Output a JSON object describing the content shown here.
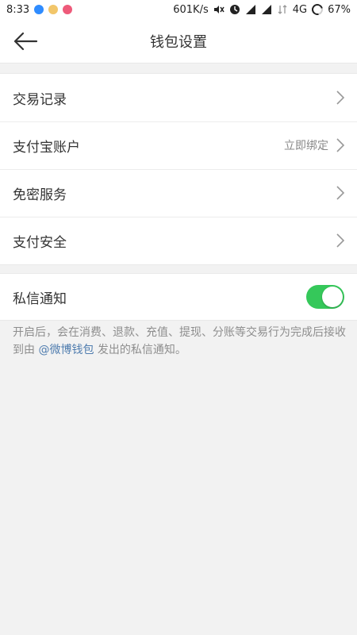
{
  "status_bar": {
    "time": "8:33",
    "network_speed": "601K/s",
    "network_type": "4G",
    "battery": "67%",
    "icons": [
      "mute-icon",
      "alarm-icon",
      "signal-icon",
      "signal-icon",
      "data-arrows-icon",
      "battery-ring-icon"
    ]
  },
  "nav": {
    "title": "钱包设置",
    "back_icon": "back-arrow-icon"
  },
  "settings": {
    "items": [
      {
        "label": "交易记录",
        "value": ""
      },
      {
        "label": "支付宝账户",
        "value": "立即绑定"
      },
      {
        "label": "免密服务",
        "value": ""
      },
      {
        "label": "支付安全",
        "value": ""
      }
    ]
  },
  "notification": {
    "label": "私信通知",
    "enabled": true,
    "toggle_color": "#35c85a"
  },
  "description": {
    "part1": "开启后，会在消费、退款、充值、提现、分账等交易行为完成后接收到由 ",
    "link": "@微博钱包",
    "part2": " 发出的私信通知。"
  }
}
